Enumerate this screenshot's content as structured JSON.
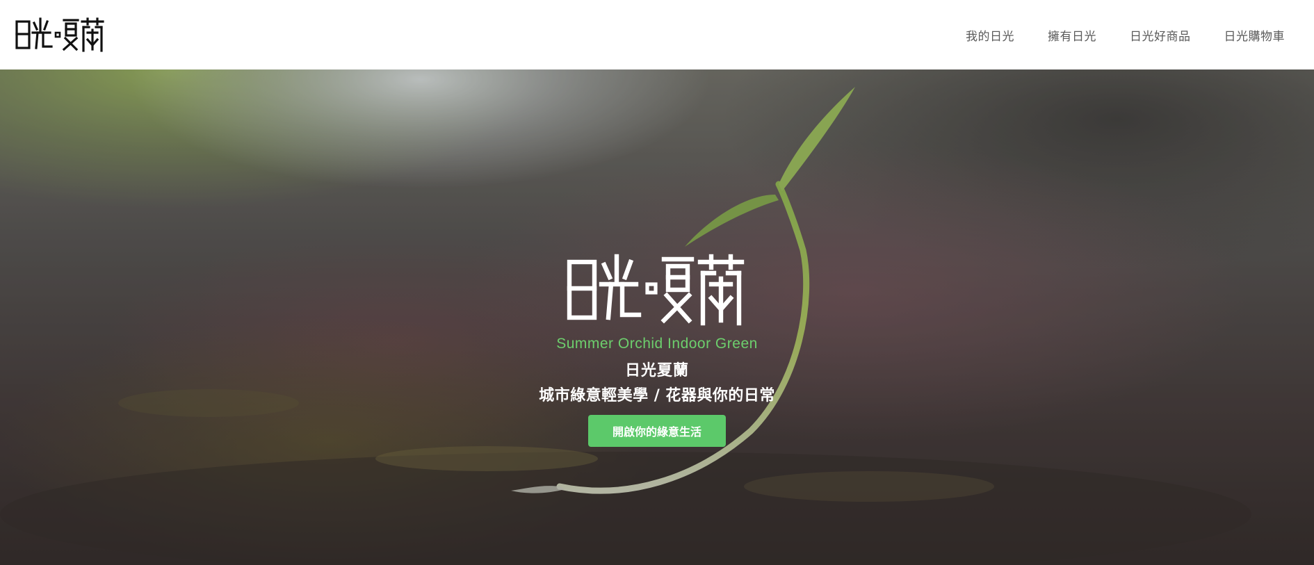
{
  "brand": {
    "logo_text": "日光·夏蘭"
  },
  "nav": {
    "items": [
      {
        "label": "我的日光"
      },
      {
        "label": "擁有日光"
      },
      {
        "label": "日光好商品"
      },
      {
        "label": "日光購物車"
      }
    ]
  },
  "hero": {
    "logo_text": "日光·夏蘭",
    "subtitle_en": "Summer Orchid Indoor Green",
    "title": "日光夏蘭",
    "description": "城市綠意輕美學 / 花器與你的日常",
    "cta_label": "開啟你的綠意生活"
  },
  "colors": {
    "accent": "#6dcf6d",
    "button": "#5cc96a",
    "nav_text": "#5a5a5a"
  },
  "icons": {
    "logo": "brand-logo-icon",
    "hero_logo": "brand-logo-large-icon"
  }
}
